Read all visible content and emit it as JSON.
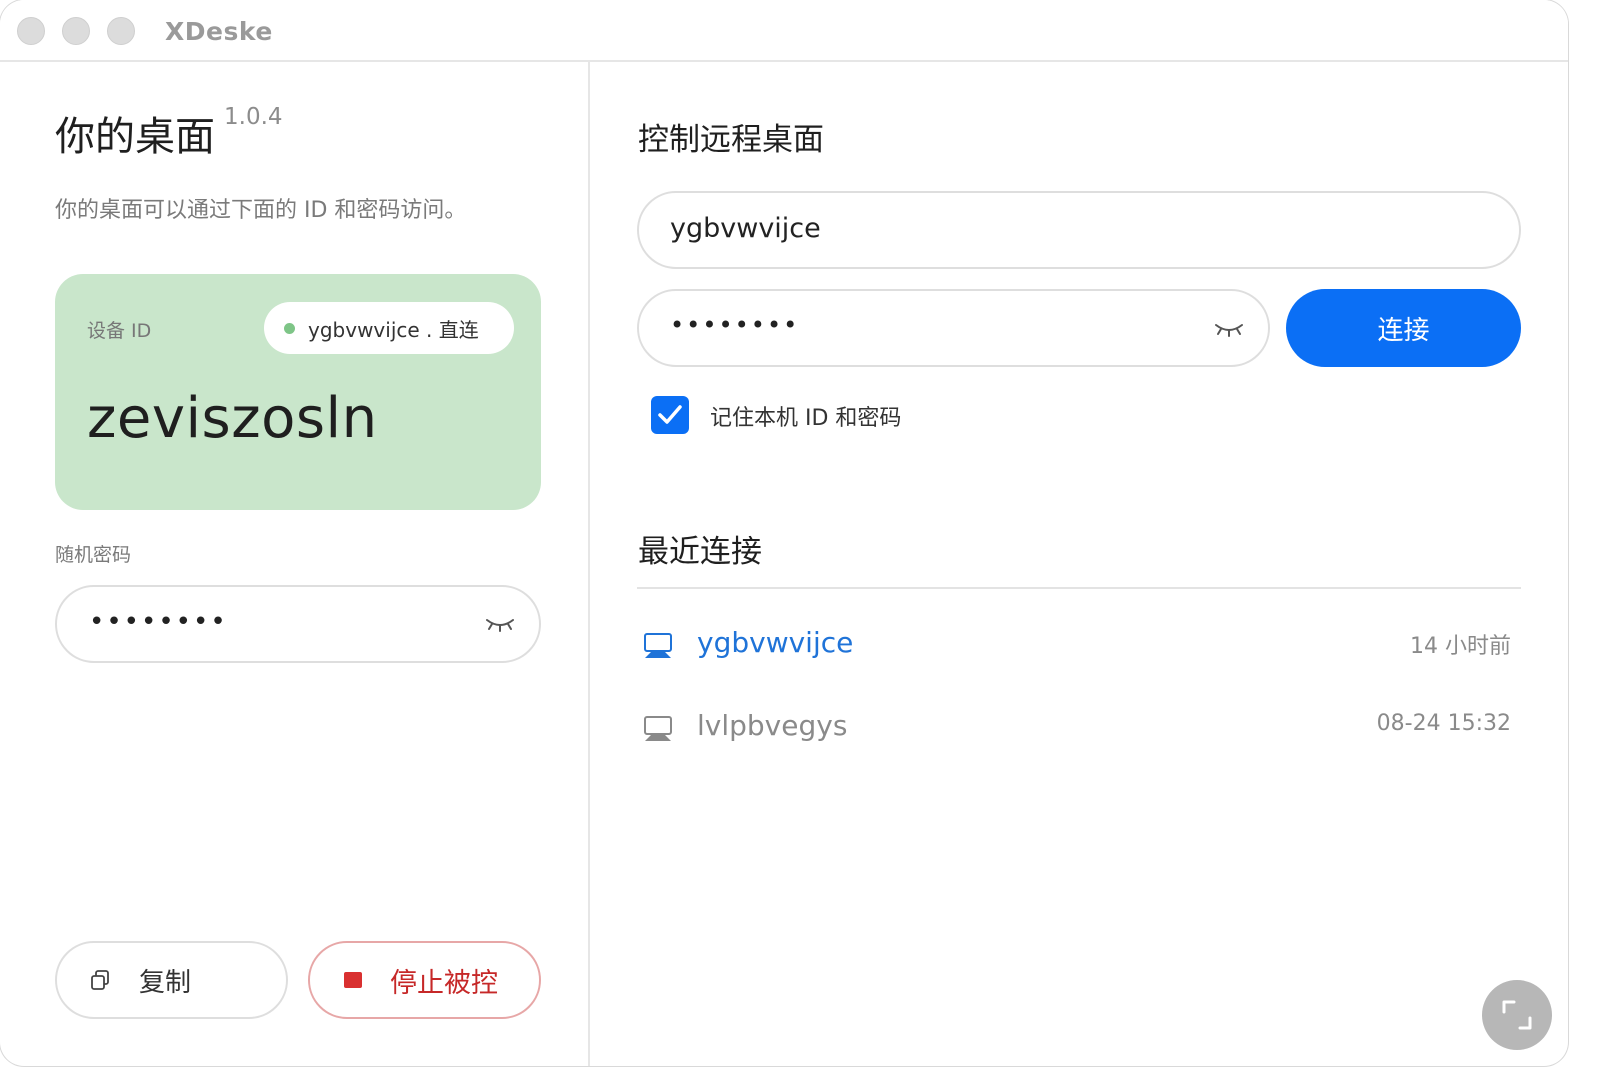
{
  "window": {
    "title": "XDeske"
  },
  "left": {
    "title": "你的桌面",
    "version": "1.0.4",
    "description": "你的桌面可以通过下面的 ID 和密码访问。",
    "id_card": {
      "label": "设备 ID",
      "peer_status": "ygbvwvijce . 直连",
      "device_id": "zeviszosln",
      "status_color": "#7ec587",
      "background": "#c9e6cb"
    },
    "password_label": "随机密码",
    "password_mask": "••••••••",
    "copy_label": "复制",
    "stop_label": "停止被控"
  },
  "right": {
    "title": "控制远程桌面",
    "remote_id_value": "ygbvwvijce",
    "remote_password_mask": "••••••••",
    "connect_label": "连接",
    "remember_label": "记住本机 ID 和密码",
    "remember_checked": true,
    "recent_title": "最近连接",
    "recent": [
      {
        "name": "ygbvwvijce",
        "time": "14 小时前",
        "active": true
      },
      {
        "name": "lvlpbvegys",
        "time": "08-24 15:32",
        "active": false
      }
    ]
  },
  "colors": {
    "accent": "#0b6ff5",
    "danger": "#c62828",
    "link": "#1f73d8"
  }
}
